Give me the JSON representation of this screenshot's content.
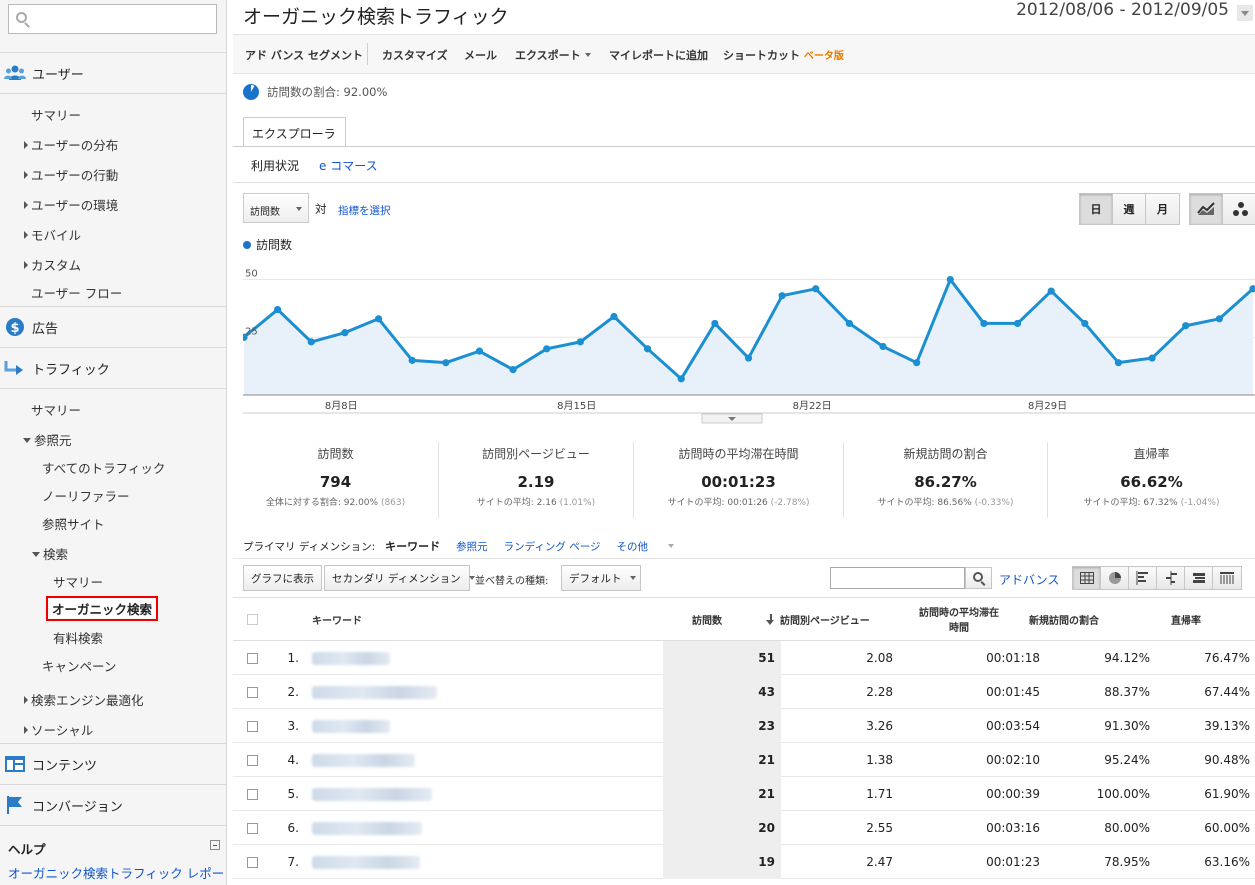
{
  "sidebar": {
    "search_placeholder": "",
    "sections": {
      "users": "ユーザー",
      "ads": "広告",
      "traffic": "トラフィック",
      "content": "コンテンツ",
      "conversion": "コンバージョン"
    },
    "users_items": [
      "サマリー",
      "ユーザーの分布",
      "ユーザーの行動",
      "ユーザーの環境",
      "モバイル",
      "カスタム",
      "ユーザー フロー"
    ],
    "traffic_items": {
      "summary": "サマリー",
      "referral": "参照元",
      "all_traffic": "すべてのトラフィック",
      "no_referrer": "ノーリファラー",
      "referral_sites": "参照サイト",
      "search": "検索",
      "search_summary": "サマリー",
      "organic": "オーガニック検索",
      "paid": "有料検索",
      "campaign": "キャンペーン",
      "seo": "検索エンジン最適化",
      "social": "ソーシャル"
    },
    "help": {
      "title": "ヘルプ",
      "link": "オーガニック検索トラフィック レポート"
    }
  },
  "header": {
    "title": "オーガニック検索トラフィック",
    "date_start": "2012/08/06",
    "date_sep": " - ",
    "date_end": "2012/09/05"
  },
  "toolbar": {
    "advanced_segment": "アド バンス セグメント",
    "customize": "カスタマイズ",
    "email": "メール",
    "export": "エクスポート",
    "add_myreport": "マイレポートに追加",
    "shortcut": "ショートカット",
    "beta": "ベータ版"
  },
  "visit_share": {
    "label": "訪問数の割合: 92.00%",
    "percent": 92.0
  },
  "tabs": {
    "explorer": "エクスプローラ",
    "usage": "利用状況",
    "ecommerce": "e コマース"
  },
  "chart_controls": {
    "metric": "訪問数",
    "vs": "対",
    "pick_metric": "指標を選択",
    "day": "日",
    "week": "週",
    "month": "月"
  },
  "chart_data": {
    "type": "area",
    "series": [
      {
        "name": "訪問数",
        "values": [
          25,
          37,
          23,
          27,
          33,
          15,
          14,
          19,
          11,
          20,
          23,
          34,
          20,
          7,
          31,
          16,
          43,
          46,
          31,
          21,
          14,
          50,
          31,
          31,
          45,
          31,
          14,
          16,
          30,
          33,
          46
        ]
      }
    ],
    "x_tick_labels": [
      "8月8日",
      "8月15日",
      "8月22日",
      "8月29日"
    ],
    "x_tick_indices": [
      2,
      9,
      16,
      23
    ],
    "y_ticks": [
      50,
      25
    ],
    "ylim": [
      0,
      55
    ],
    "color": "#1b8fd1",
    "fill": "#e8f1fa",
    "grid": true
  },
  "scorecards": [
    {
      "label": "訪問数",
      "value": "794",
      "sub": "全体に対する割合: 92.00%",
      "sub2": " (863)"
    },
    {
      "label": "訪問別ページビュー",
      "value": "2.19",
      "sub": "サイトの平均: 2.16",
      "sub2": " (1.01%)"
    },
    {
      "label": "訪問時の平均滞在時間",
      "value": "00:01:23",
      "sub": "サイトの平均: 00:01:26",
      "sub2": " (-2.78%)"
    },
    {
      "label": "新規訪問の割合",
      "value": "86.27%",
      "sub": "サイトの平均: 86.56%",
      "sub2": " (-0.33%)"
    },
    {
      "label": "直帰率",
      "value": "66.62%",
      "sub": "サイトの平均: 67.32%",
      "sub2": " (-1.04%)"
    }
  ],
  "dimension": {
    "label": "プライマリ ディメンション:",
    "keyword": "キーワード",
    "source": "参照元",
    "landing": "ランディング ページ",
    "other": "その他"
  },
  "table_controls": {
    "plot": "グラフに表示",
    "secondary": "セカンダリ ディメンション",
    "sort_label": "並べ替えの種類:",
    "sort_value": "デフォルト",
    "advance": "アドバンス"
  },
  "table": {
    "headers": {
      "keyword": "キーワード",
      "visits": "訪問数",
      "pv": "訪問別ページビュー",
      "duration_1": "訪問時の平均滞在",
      "duration_2": "時間",
      "new": "新規訪問の割合",
      "bounce": "直帰率"
    },
    "rows": [
      {
        "idx": "1.",
        "visits": "51",
        "pv": "2.08",
        "dur": "00:01:18",
        "new": "94.12%",
        "bounce": "76.47%"
      },
      {
        "idx": "2.",
        "visits": "43",
        "pv": "2.28",
        "dur": "00:01:45",
        "new": "88.37%",
        "bounce": "67.44%"
      },
      {
        "idx": "3.",
        "visits": "23",
        "pv": "3.26",
        "dur": "00:03:54",
        "new": "91.30%",
        "bounce": "39.13%"
      },
      {
        "idx": "4.",
        "visits": "21",
        "pv": "1.38",
        "dur": "00:02:10",
        "new": "95.24%",
        "bounce": "90.48%"
      },
      {
        "idx": "5.",
        "visits": "21",
        "pv": "1.71",
        "dur": "00:00:39",
        "new": "100.00%",
        "bounce": "61.90%"
      },
      {
        "idx": "6.",
        "visits": "20",
        "pv": "2.55",
        "dur": "00:03:16",
        "new": "80.00%",
        "bounce": "60.00%"
      },
      {
        "idx": "7.",
        "visits": "19",
        "pv": "2.47",
        "dur": "00:01:23",
        "new": "78.95%",
        "bounce": "63.16%"
      }
    ]
  }
}
